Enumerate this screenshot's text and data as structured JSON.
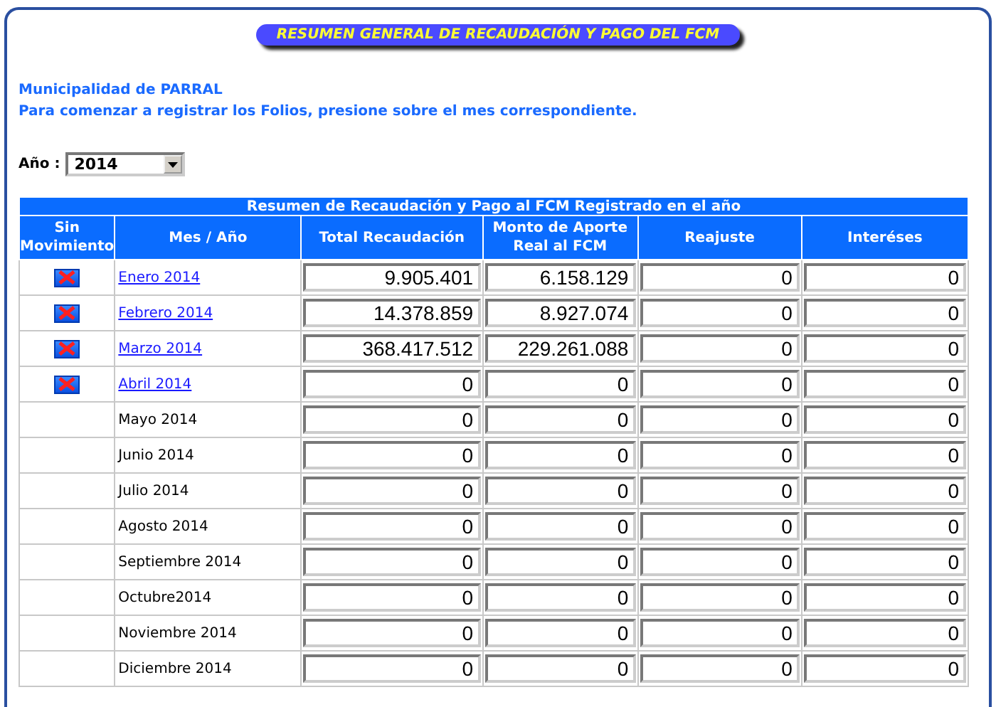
{
  "title": "RESUMEN GENERAL DE RECAUDACIÓN Y PAGO DEL FCM",
  "intro": [
    "Municipalidad de PARRAL",
    "Para comenzar a registrar los Folios, presione sobre el mes correspondiente."
  ],
  "year": {
    "label": "Año :",
    "value": "2014"
  },
  "table": {
    "caption": "Resumen de Recaudación y Pago al FCM Registrado en el año",
    "columns": [
      "Sin Movimiento",
      "Mes / Año",
      "Total Recaudación",
      "Monto de Aporte Real al FCM",
      "Reajuste",
      "Interéses"
    ],
    "rows": [
      {
        "kind": "link",
        "month": "Enero 2014",
        "values": [
          "9.905.401",
          "6.158.129",
          "0",
          "0"
        ]
      },
      {
        "kind": "link",
        "month": "Febrero 2014",
        "values": [
          "14.378.859",
          "8.927.074",
          "0",
          "0"
        ]
      },
      {
        "kind": "link",
        "month": "Marzo 2014",
        "values": [
          "368.417.512",
          "229.261.088",
          "0",
          "0"
        ]
      },
      {
        "kind": "link",
        "month": "Abril 2014",
        "values": [
          "0",
          "0",
          "0",
          "0"
        ]
      },
      {
        "kind": "plain",
        "month": "Mayo 2014",
        "values": [
          "0",
          "0",
          "0",
          "0"
        ]
      },
      {
        "kind": "plain",
        "month": "Junio 2014",
        "values": [
          "0",
          "0",
          "0",
          "0"
        ]
      },
      {
        "kind": "plain",
        "month": "Julio 2014",
        "values": [
          "0",
          "0",
          "0",
          "0"
        ]
      },
      {
        "kind": "plain",
        "month": "Agosto 2014",
        "values": [
          "0",
          "0",
          "0",
          "0"
        ]
      },
      {
        "kind": "plain",
        "month": "Septiembre 2014",
        "values": [
          "0",
          "0",
          "0",
          "0"
        ]
      },
      {
        "kind": "plain",
        "month": "Octubre2014",
        "values": [
          "0",
          "0",
          "0",
          "0"
        ]
      },
      {
        "kind": "plain",
        "month": "Noviembre 2014",
        "values": [
          "0",
          "0",
          "0",
          "0"
        ]
      },
      {
        "kind": "plain",
        "month": "Diciembre 2014",
        "values": [
          "0",
          "0",
          "0",
          "0"
        ]
      }
    ]
  }
}
